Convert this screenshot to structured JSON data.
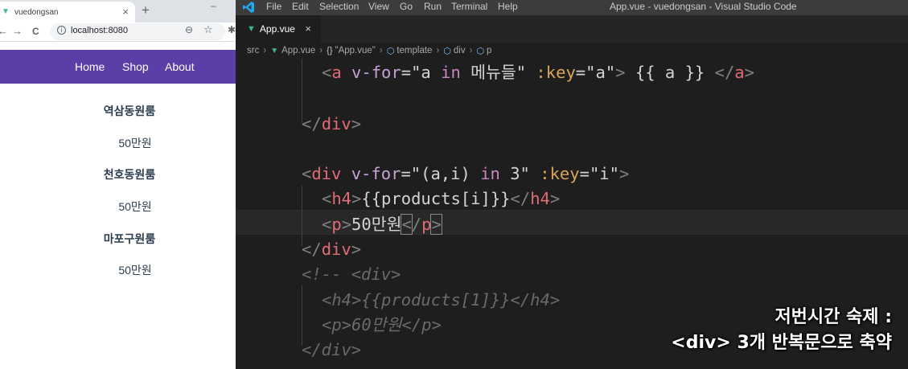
{
  "browser": {
    "tab_title": "vuedongsan",
    "tab_close": "×",
    "new_tab": "+",
    "minimize": "–",
    "back": "←",
    "forward": "→",
    "reload": "C",
    "info": "i",
    "url": "localhost:8080",
    "zoom": "⊖",
    "star": "☆",
    "extension": "✱"
  },
  "site": {
    "nav": [
      "Home",
      "Shop",
      "About"
    ],
    "products": [
      {
        "name": "역삼동원룸",
        "price": "50만원"
      },
      {
        "name": "천호동원룸",
        "price": "50만원"
      },
      {
        "name": "마포구원룸",
        "price": "50만원"
      }
    ]
  },
  "vscode": {
    "menu": [
      "File",
      "Edit",
      "Selection",
      "View",
      "Go",
      "Run",
      "Terminal",
      "Help"
    ],
    "window_title": "App.vue - vuedongsan - Visual Studio Code",
    "tab_label": "App.vue",
    "tab_close": "×",
    "breadcrumb": {
      "src": "src",
      "file": "App.vue",
      "braces": "{}",
      "component": "\"App.vue\"",
      "template": "template",
      "div": "div",
      "p": "p"
    },
    "code": {
      "l1": {
        "open": "<",
        "tag": "a",
        "attr1": "v-for",
        "eq": "=",
        "q1": "\"a ",
        "kw": "in",
        "q2": " 메뉴들\" ",
        "attr2": ":key",
        "eq2": "=",
        "val2": "\"a\"",
        "close": ">",
        "text": " {{ a }} ",
        "endopen": "</",
        "endtag": "a",
        "endclose": ">"
      },
      "l3": {
        "open": "</",
        "tag": "div",
        "close": ">"
      },
      "l5": {
        "open": "<",
        "tag": "div",
        "attr1": "v-for",
        "eq": "=",
        "q1": "\"(a,i) ",
        "kw": "in",
        "q2": " 3\" ",
        "attr2": ":key",
        "eq2": "=",
        "val2": "\"i\"",
        "close": ">"
      },
      "l6": {
        "open": "<",
        "tag": "h4",
        "close": ">",
        "text": "{{products[i]}}",
        "endopen": "</",
        "endtag": "h4",
        "endclose": ">"
      },
      "l7": {
        "open": "<",
        "tag": "p",
        "close": ">",
        "text": "50만원",
        "endopen": "<",
        "slash": "/",
        "endtag": "p",
        "endclose": ">"
      },
      "l8": {
        "open": "</",
        "tag": "div",
        "close": ">"
      },
      "l9": "<!-- <div>",
      "l10": "<h4>{{products[1]}}</h4>",
      "l11": "<p>60만원</p>",
      "l12": "</div>"
    }
  },
  "subtitle": {
    "line1": "저번시간 숙제 :",
    "line2": "<div> 3개 반복문으로 축약"
  }
}
